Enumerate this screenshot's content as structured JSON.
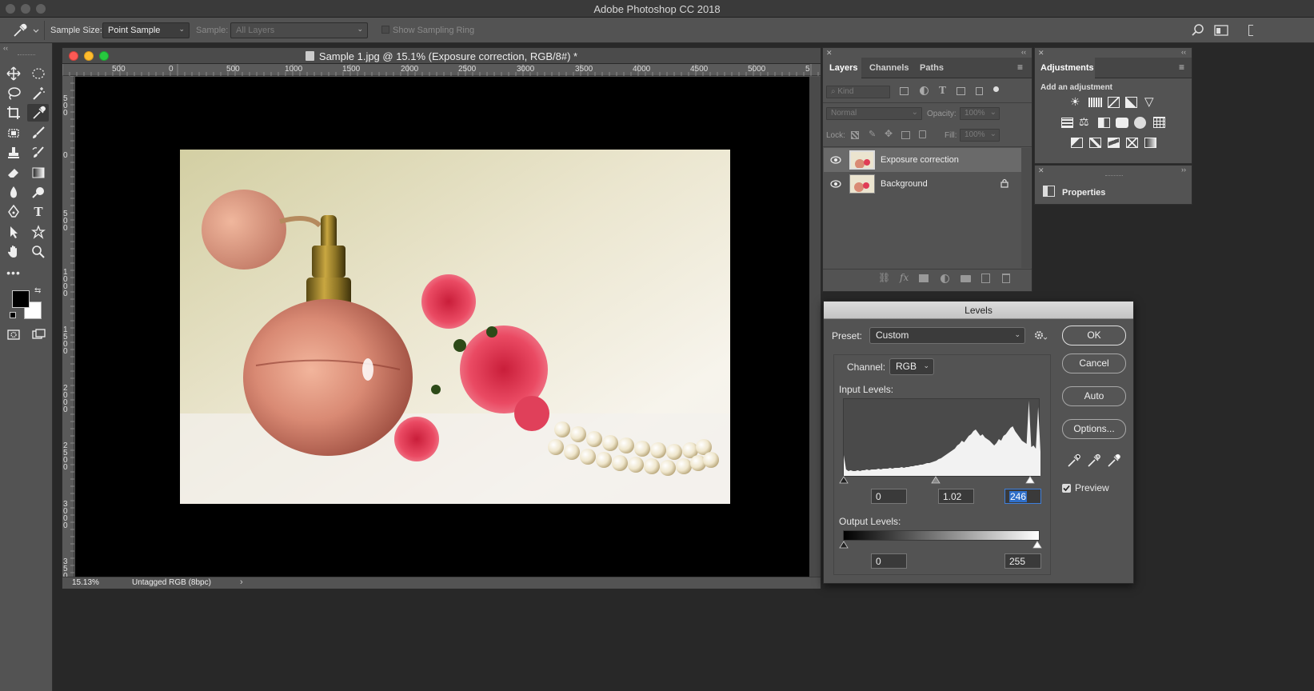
{
  "app": {
    "title": "Adobe Photoshop CC 2018"
  },
  "options_bar": {
    "sample_size_label": "Sample Size:",
    "sample_size_value": "Point Sample",
    "sample_label": "Sample:",
    "sample_value": "All Layers",
    "show_ring_label": "Show Sampling Ring"
  },
  "document": {
    "title": "Sample 1.jpg @ 15.1% (Exposure correction, RGB/8#) *",
    "zoom": "15.13%",
    "color_profile": "Untagged RGB (8bpc)",
    "ruler_h_labels": [
      "500",
      "0",
      "500",
      "1000",
      "1500",
      "2000",
      "2500",
      "3000",
      "3500",
      "4000",
      "4500",
      "5000",
      "5"
    ],
    "ruler_v_labels": [
      "500",
      "0",
      "500",
      "1000",
      "1500",
      "2000",
      "2500",
      "3000",
      "350"
    ]
  },
  "layers_panel": {
    "tabs": [
      "Layers",
      "Channels",
      "Paths"
    ],
    "filter_kind": "Kind",
    "blend_mode": "Normal",
    "opacity_label": "Opacity:",
    "opacity_value": "100%",
    "lock_label": "Lock:",
    "fill_label": "Fill:",
    "fill_value": "100%",
    "layers": [
      {
        "name": "Exposure correction",
        "selected": true,
        "locked": false
      },
      {
        "name": "Background",
        "selected": false,
        "locked": true
      }
    ]
  },
  "adjustments_panel": {
    "tab": "Adjustments",
    "subtitle": "Add an adjustment"
  },
  "properties_panel": {
    "title": "Properties"
  },
  "levels_dialog": {
    "title": "Levels",
    "preset_label": "Preset:",
    "preset_value": "Custom",
    "channel_label": "Channel:",
    "channel_value": "RGB",
    "input_levels_label": "Input Levels:",
    "input_black": "0",
    "input_gamma": "1.02",
    "input_white": "246",
    "output_levels_label": "Output Levels:",
    "output_black": "0",
    "output_white": "255",
    "buttons": {
      "ok": "OK",
      "cancel": "Cancel",
      "auto": "Auto",
      "options": "Options..."
    },
    "preview_label": "Preview",
    "preview_checked": true
  },
  "colors": {
    "ui_dark": "#535353",
    "ui_darker": "#3a3a3a",
    "canvas_bg": "#000000",
    "selection_blue": "#2f6fc9"
  }
}
